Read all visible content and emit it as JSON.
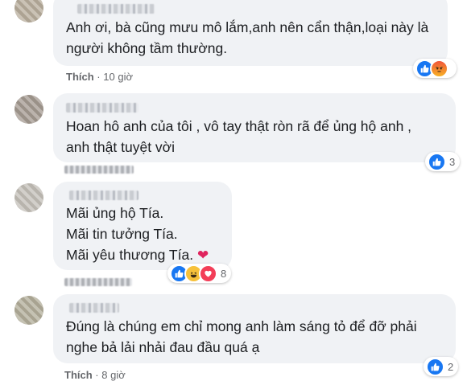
{
  "comments": [
    {
      "avatar": "avatar-blurred",
      "lines": "Anh ơi, bà cũng mưu mô lắm,anh nên cẩn thận,loại này là\nngười không tầm thường.",
      "like_label": "Thích",
      "time": "10 giờ",
      "reactions": [
        "like",
        "angry"
      ],
      "reaction_count": ""
    },
    {
      "avatar": "avatar-blurred",
      "lines": "Hoan hô anh của tôi , vô tay thật ròn rã để ủng hộ anh ,\nanh thật tuyệt vời",
      "reactions": [
        "like"
      ],
      "reaction_count": "3"
    },
    {
      "avatar": "avatar-blurred",
      "lines": "Mãi ủng hộ Tía.\nMãi tin tưởng Tía.\nMãi yêu thương Tía.",
      "emoji": "heart-icon",
      "reactions": [
        "like",
        "haha",
        "love"
      ],
      "reaction_count": "8"
    },
    {
      "avatar": "avatar-blurred",
      "lines": "Đúng là chúng em chỉ mong anh làm sáng tỏ để đỡ phải\nnghe bả lải nhải đau đầu quá ạ",
      "like_label": "Thích",
      "time": "8 giờ",
      "reactions": [
        "like"
      ],
      "reaction_count": "2"
    }
  ],
  "separator": "·",
  "colors": {
    "bubble": "#f0f2f5",
    "like_blue": "#1877f2",
    "love_red": "#f33e58",
    "meta_gray": "#65676b"
  }
}
